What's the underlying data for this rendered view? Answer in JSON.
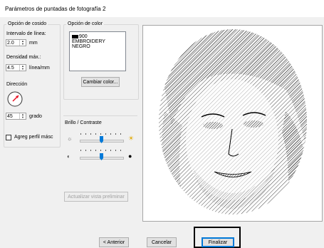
{
  "window": {
    "title": "Parámetros de puntadas de fotografía 2"
  },
  "stitch_options": {
    "legend": "Opción de cosido",
    "interval_label": "Intervalo de línea:",
    "interval_value": "2.0",
    "interval_unit": "mm",
    "density_label": "Densidad máx.:",
    "density_value": "4.5",
    "density_unit": "línea/mm",
    "direction_label": "Dirección",
    "angle_value": "45",
    "angle_unit": "grado",
    "outline_checkbox_label": "Agreg perfil másc",
    "outline_checked": false
  },
  "color_options": {
    "legend": "Opción de color",
    "list": [
      {
        "code": "900",
        "lines": [
          "EMBROIDERY",
          "NEGRO"
        ],
        "swatch": "#000000"
      }
    ],
    "change_color_button": "Cambiar color..."
  },
  "brightness_contrast": {
    "label": "Brillo / Contraste",
    "brightness_level": 0.5,
    "contrast_level": 0.5
  },
  "update_preview_button": "Actualizar vista preliminar",
  "footer": {
    "back_button": "< Anterior",
    "cancel_button": "Cancelar",
    "finish_button": "Finalizar"
  },
  "colors": {
    "accent": "#0078d7",
    "dial_arrow": "#e81123",
    "slider_thumb": "#007ad9"
  }
}
